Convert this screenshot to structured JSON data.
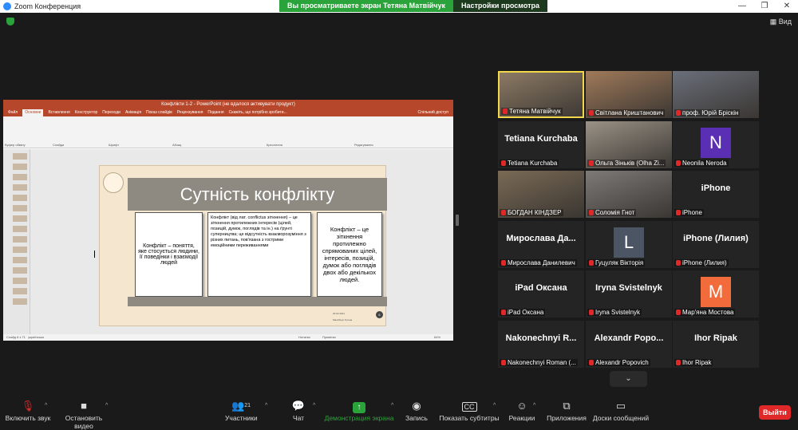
{
  "window": {
    "title": "Zoom Конференция"
  },
  "share_banner": {
    "viewing_text": "Вы просматриваете экран Тетяна Матвійчук",
    "view_options": "Настройки просмотра"
  },
  "topbar": {
    "view_label": "Вид"
  },
  "powerpoint": {
    "title": "Конфлікти 1-2 - PowerPoint (не вдалося активувати продукт)",
    "tabs": [
      "Файл",
      "Основне",
      "Вставлення",
      "Конструктор",
      "Переходи",
      "Анімація",
      "Показ слайдів",
      "Рецензування",
      "Подання",
      "Скажіть, що потрібно зробити...",
      "Спільний доступ"
    ],
    "ribbon_groups": [
      "Буфер обміну",
      "Слайди",
      "Шрифт",
      "Абзац",
      "Креслення",
      "Редагування"
    ],
    "status": {
      "slide": "Слайд 6 з 71",
      "lang": "українська",
      "notes": "Нотатки",
      "comments": "Примітки",
      "zoom": "64%"
    },
    "slide": {
      "title": "Сутність конфлікту",
      "card1": "Конфлікт – поняття, яке стосується людини, її поведінки і взаємодії людей",
      "card2": "Конфлікт (від лат. conflictus зіткнення) – це зіткнення протилежних інтересів (цілей, позицій, думок, поглядів та ін.) на ґрунті суперництва; це відсутність взаєморозуміння з різних питань, пов'язана з гострими емоційними переживаннями",
      "card3": "Конфлікт – це зіткнення протилежно спрямованих цілей, інтересів, позицій, думок або поглядів двох або декількох людей.",
      "number": "6",
      "date": "20.02.2021",
      "footer": "Матвійчук Тетяна"
    }
  },
  "participants": [
    {
      "label": "Тетяна Матвійчук",
      "type": "video",
      "active": true
    },
    {
      "label": "Світлана Криштанович",
      "type": "video"
    },
    {
      "label": "проф. Юрій Бріскін",
      "type": "video"
    },
    {
      "big": "Tetiana Kurchaba",
      "label": "Tetiana Kurchaba",
      "type": "name"
    },
    {
      "label": "Ольга Зіньків (Olha Zi...",
      "type": "photo"
    },
    {
      "avatar": "N",
      "label": "Neonila Neroda",
      "type": "avatar",
      "color": "#5b2fb3"
    },
    {
      "label": "БОГДАН КІНДЗЕР",
      "type": "video"
    },
    {
      "label": "Соломія Гнот",
      "type": "video"
    },
    {
      "big": "iPhone",
      "label": "iPhone",
      "type": "name"
    },
    {
      "big": "Мирослава Да...",
      "label": "Мирослава Данилевич",
      "type": "name"
    },
    {
      "avatar": "L",
      "label": "Гуцуляк Вікторія",
      "type": "avatar",
      "color": "#4b5563"
    },
    {
      "big": "iPhone (Лилия)",
      "label": "iPhone (Лилия)",
      "type": "name"
    },
    {
      "big": "iPad Оксана",
      "label": "iPad Оксана",
      "type": "name"
    },
    {
      "big": "Iryna Svistelnyk",
      "label": "Iryna Svistelnyk",
      "type": "name"
    },
    {
      "avatar": "M",
      "label": "Мар'яна Мостова",
      "type": "avatar",
      "color": "#f26b3a"
    },
    {
      "big": "Nakonechnyi R...",
      "label": "Nakonechnyi Roman (...",
      "type": "name"
    },
    {
      "big": "Alexandr Popo...",
      "label": "Alexandr Popovich",
      "type": "name"
    },
    {
      "big": "Ihor Ripak",
      "label": "Ihor Ripak",
      "type": "name"
    }
  ],
  "toolbar": {
    "mute": "Включить звук",
    "video": "Остановить видео",
    "participants": "Участники",
    "participants_count": "21",
    "chat": "Чат",
    "share": "Демонстрация экрана",
    "record": "Запись",
    "captions": "Показать субтитры",
    "reactions": "Реакции",
    "apps": "Приложения",
    "whiteboards": "Доски сообщений",
    "leave": "Выйти"
  }
}
